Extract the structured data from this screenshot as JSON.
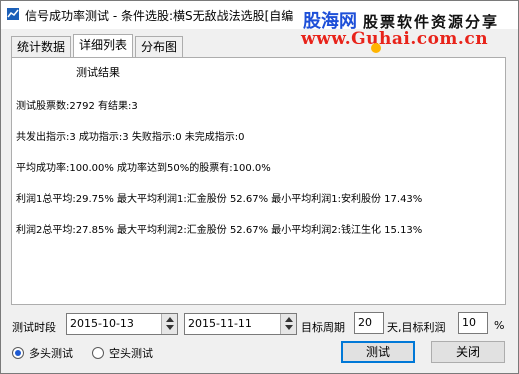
{
  "window": {
    "title": "信号成功率测试 - 条件选股:横S无敌战法选股[自编"
  },
  "watermark": {
    "brand": "股海网",
    "slogan": "股票软件资源分享",
    "url": "www.Guhai.com.cn"
  },
  "tabs": [
    {
      "label": "统计数据",
      "active": false
    },
    {
      "label": "详细列表",
      "active": true
    },
    {
      "label": "分布图",
      "active": false
    }
  ],
  "results": {
    "heading": "测试结果",
    "lines": [
      "测试股票数:2792 有结果:3",
      "共发出指示:3 成功指示:3 失败指示:0 未完成指示:0",
      "平均成功率:100.00% 成功率达到50%的股票有:100.0%",
      "利润1总平均:29.75% 最大平均利润1:汇金股份 52.67% 最小平均利润1:安利股份 17.43%",
      "利润2总平均:27.85% 最大平均利润2:汇金股份 52.67% 最小平均利润2:钱江生化 15.13%"
    ]
  },
  "controls": {
    "period_label": "测试时段",
    "start_date": "2015-10-13",
    "end_date": "2015-11-11",
    "target_period_label": "目标周期",
    "target_period_value": "20",
    "target_profit_label": "天,目标利润",
    "target_profit_value": "10",
    "percent_sign": "%",
    "radio_long": "多头测试",
    "radio_short": "空头测试",
    "radio_selected": "long",
    "test_button": "测试",
    "close_button": "关闭"
  }
}
